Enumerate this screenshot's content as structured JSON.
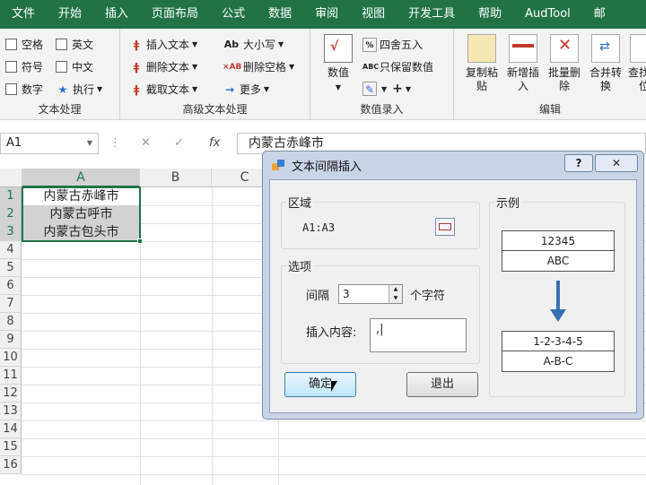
{
  "ribbon_tabs": [
    "文件",
    "开始",
    "插入",
    "页面布局",
    "公式",
    "数据",
    "审阅",
    "视图",
    "开发工具",
    "帮助",
    "AudTool",
    "邮"
  ],
  "groups": {
    "text_processing": {
      "label": "文本处理",
      "checkboxes": [
        "空格",
        "英文",
        "符号",
        "中文",
        "数字"
      ],
      "execute": "执行"
    },
    "advanced_text": {
      "label": "高级文本处理",
      "insert_text": "插入文本",
      "delete_text": "删除文本",
      "extract_text": "截取文本",
      "case": "大小写",
      "delete_space": "删除空格",
      "more": "更多"
    },
    "value_entry": {
      "label": "数值录入",
      "value": "数值",
      "round": "四舍五入",
      "keep_value": "只保留数值"
    },
    "edit": {
      "label": "编辑",
      "buttons": [
        "复制粘贴",
        "新增插入",
        "批量删除",
        "合并转换",
        "查找定位"
      ]
    }
  },
  "formula_bar": {
    "name_box": "A1",
    "fx": "fx",
    "content": "内蒙古赤峰市"
  },
  "columns": [
    "A",
    "B",
    "C"
  ],
  "rows": [
    "1",
    "2",
    "3",
    "4",
    "5",
    "6",
    "7",
    "8",
    "9",
    "10",
    "11",
    "12",
    "13",
    "14",
    "15",
    "16"
  ],
  "cells": [
    "内蒙古赤峰市",
    "内蒙古呼市",
    "内蒙古包头市"
  ],
  "dialog": {
    "title": "文本间隔插入",
    "help": "?",
    "close": "✕",
    "region_label": "区域",
    "region_value": "A1:A3",
    "options_label": "选项",
    "interval_label": "间隔",
    "interval_value": "3",
    "interval_unit": "个字符",
    "insert_label": "插入内容:",
    "insert_value": ",|",
    "example_label": "示例",
    "example_before": [
      "12345",
      "ABC"
    ],
    "example_after": [
      "1-2-3-4-5",
      "A-B-C"
    ],
    "ok": "确定",
    "exit": "退出"
  }
}
